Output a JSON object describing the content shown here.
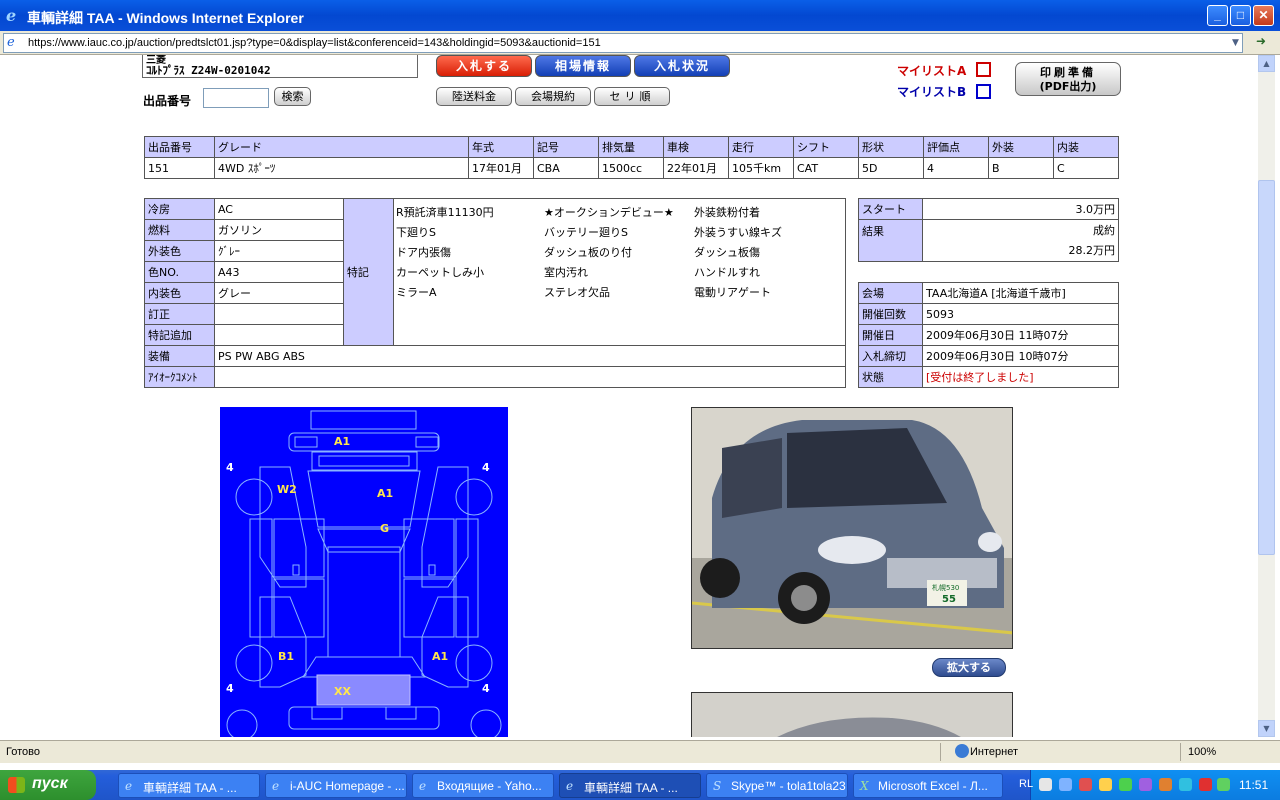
{
  "window": {
    "title": "車輌詳細 TAA - Windows Internet Explorer",
    "min": "_",
    "max": "□",
    "close": "✕"
  },
  "address": {
    "url": "https://www.iauc.co.jp/auction/predtslct01.jsp?type=0&display=list&conferenceid=143&holdingid=5093&auctionid=151"
  },
  "header": {
    "maker_top": "三菱",
    "vehicle_line": "ｺﾙﾄﾌﾟﾗｽ  Z24W-0201042",
    "lot_label": "出品番号",
    "lot_value": "",
    "search_button": "検索",
    "bid_button": "入札する",
    "market_button": "相場情報",
    "bid_status_button": "入札状況",
    "transport_button": "陸送料金",
    "rules_button": "会場規約",
    "auction_order_button": "セリ順",
    "mylist_a": "マイリストA",
    "mylist_b": "マイリストB",
    "pdf_line1": "印刷準備",
    "pdf_line2": "(PDF出力)"
  },
  "summary": {
    "headers": [
      "出品番号",
      "グレード",
      "年式",
      "記号",
      "排気量",
      "車検",
      "走行",
      "シフト",
      "形状",
      "評価点",
      "外装",
      "内装"
    ],
    "values": [
      "151",
      "4WD ｽﾎﾟｰﾂ",
      "17年01月",
      "CBA",
      "1500cc",
      "22年01月",
      "105千km",
      "CAT",
      "5D",
      "4",
      "B",
      "C"
    ]
  },
  "details": {
    "rows": [
      {
        "label": "冷房",
        "value": "AC"
      },
      {
        "label": "燃料",
        "value": "ガソリン"
      },
      {
        "label": "外装色",
        "value": "ｸﾞﾚｰ"
      },
      {
        "label": "色NO.",
        "value": "A43"
      },
      {
        "label": "内装色",
        "value": "グレー"
      },
      {
        "label": "訂正",
        "value": ""
      },
      {
        "label": "特記追加",
        "value": ""
      }
    ],
    "special_label": "特記",
    "notes": [
      "R預託済車11130円",
      "★オークションデビュー★",
      "外装鉄粉付着",
      "下廻りS",
      "バッテリー廻りS",
      "外装うすい線キズ",
      "ドア内張傷",
      "ダッシュ板のり付",
      "ダッシュ板傷",
      "カーペットしみ小",
      "室内汚れ",
      "ハンドルすれ",
      "ミラーA",
      "ステレオ欠品",
      "電動リアゲート"
    ],
    "equipment_label": "装備",
    "equipment_value": "PS PW ABG ABS",
    "comment_label": "ｱｲｵｰｸｺﾒﾝﾄ",
    "comment_value": ""
  },
  "result": {
    "start_label": "スタート",
    "start_value": "3.0万円",
    "result_label": "結果",
    "result_status": "成約",
    "result_price": "28.2万円"
  },
  "venue": {
    "rows": [
      {
        "label": "会場",
        "value": "TAA北海道A [北海道千歳市]"
      },
      {
        "label": "開催回数",
        "value": "5093"
      },
      {
        "label": "開催日",
        "value": "2009年06月30日 11時07分"
      },
      {
        "label": "入札締切",
        "value": "2009年06月30日 10時07分"
      },
      {
        "label": "状態",
        "value": "[受付は終了しました]"
      }
    ],
    "status_color": "#cc0000"
  },
  "diagram": {
    "marks": [
      "A1",
      "A1",
      "W2",
      "G",
      "B1",
      "A1",
      "XX",
      "4",
      "4",
      "4",
      "4"
    ]
  },
  "photo": {
    "zoom_button": "拡大する",
    "plate_line1": "札幌530",
    "plate_line2": "55"
  },
  "status": {
    "text": "Готово",
    "zone": "Интернет",
    "zoom": "100%"
  },
  "taskbar": {
    "start": "пуск",
    "items": [
      "車輌詳細 TAA - ...",
      "i-AUC Homepage - ...",
      "Входящие - Yaho...",
      "車輌詳細 TAA - ...",
      "Skype™ - tola1tola23",
      "Microsoft Excel - Л..."
    ],
    "lang": "RL",
    "clock": "11:51"
  }
}
